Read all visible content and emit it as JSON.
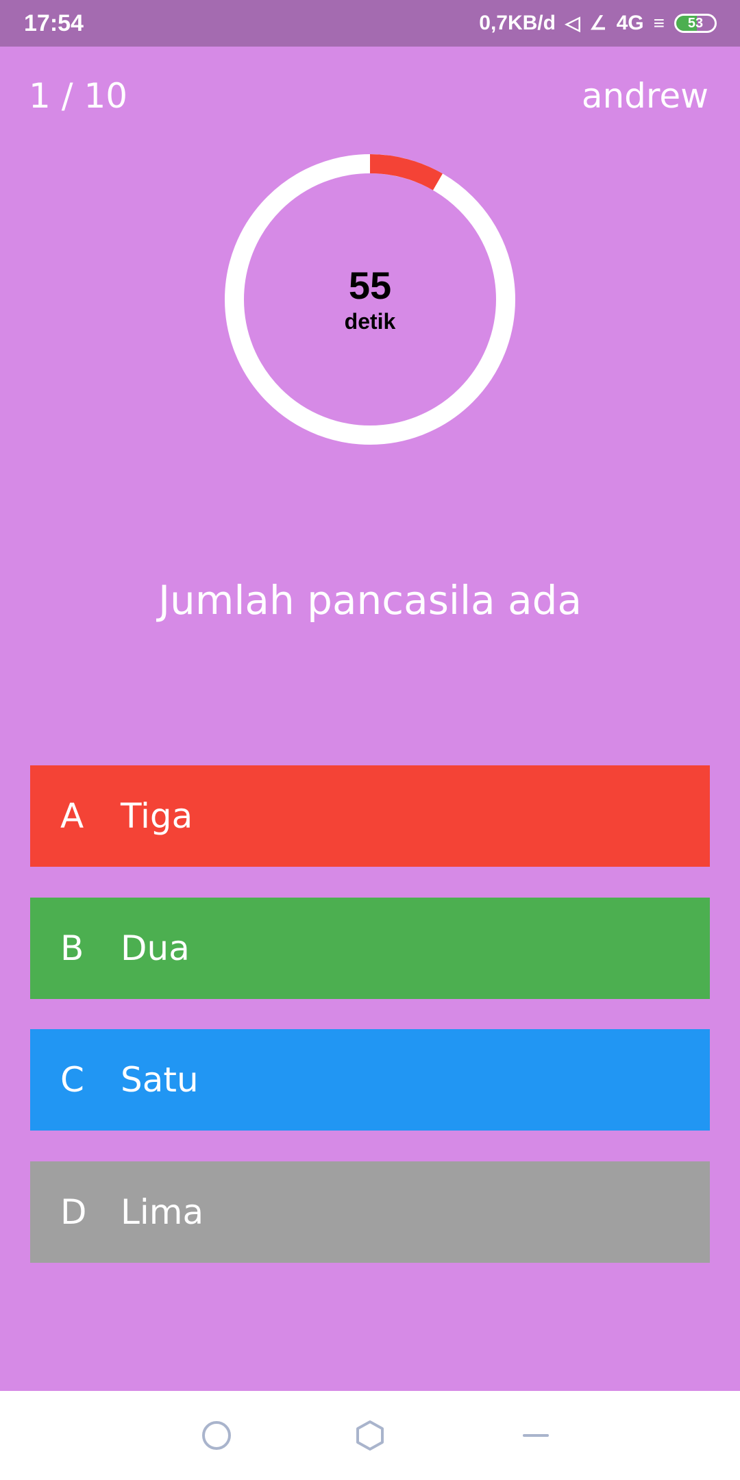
{
  "status_bar": {
    "time": "17:54",
    "network_speed": "0,7KB/d",
    "network_type": "4G",
    "battery_level": "53",
    "icons": [
      "notification-icon",
      "signal-icon",
      "wifi-icon",
      "battery-icon"
    ]
  },
  "quiz": {
    "progress": "1 / 10",
    "username": "andrew",
    "timer": {
      "value": "55",
      "unit": "detik",
      "elapsed_fraction": 0.0833,
      "ring_color": "#ffffff",
      "elapsed_color": "#f44336"
    },
    "question": "Jumlah pancasila ada",
    "answers": [
      {
        "letter": "A",
        "text": "Tiga",
        "color": "#f44336"
      },
      {
        "letter": "B",
        "text": "Dua",
        "color": "#4caf50"
      },
      {
        "letter": "C",
        "text": "Satu",
        "color": "#2196f3"
      },
      {
        "letter": "D",
        "text": "Lima",
        "color": "#a0a0a0"
      }
    ]
  },
  "colors": {
    "background": "#d68ae6",
    "status_bar": "#a46bb0",
    "nav_icons": "#a9b4cc"
  },
  "nav_bar": {
    "icons": [
      "home-circle-icon",
      "hexagon-icon",
      "menu-line-icon"
    ]
  }
}
